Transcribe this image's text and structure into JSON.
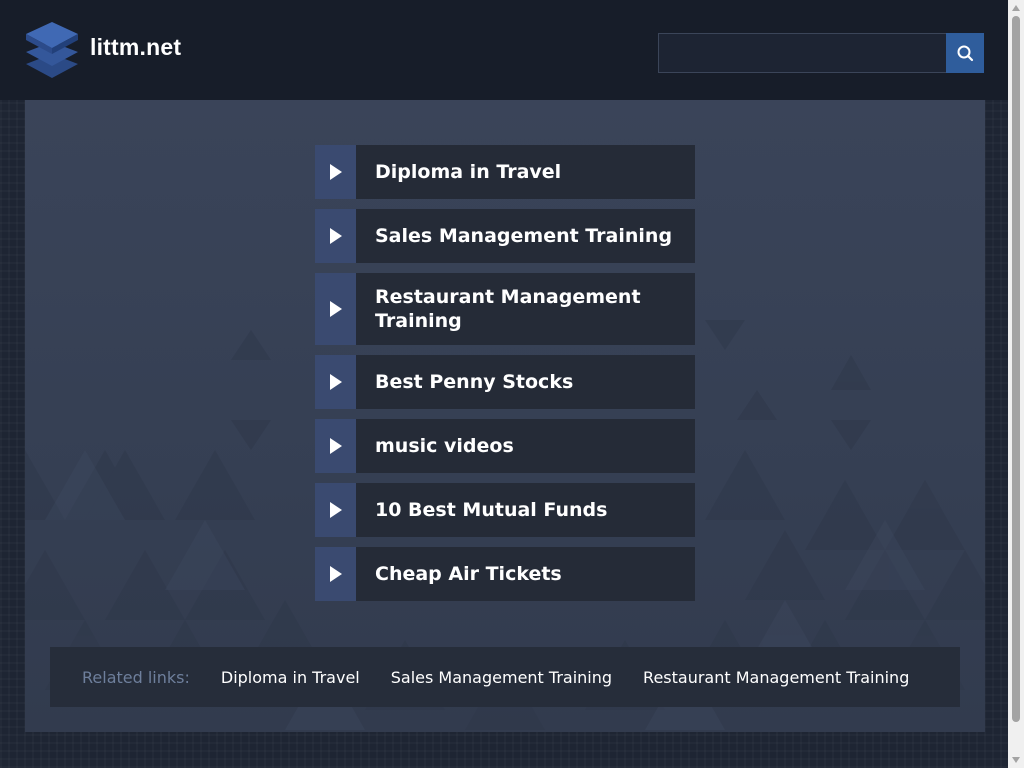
{
  "site": {
    "title": "littm.net"
  },
  "search": {
    "value": "",
    "placeholder": ""
  },
  "links": [
    {
      "label": "Diploma in Travel"
    },
    {
      "label": "Sales Management Training"
    },
    {
      "label": "Restaurant Management Training"
    },
    {
      "label": "Best Penny Stocks"
    },
    {
      "label": "music videos"
    },
    {
      "label": "10 Best Mutual Funds"
    },
    {
      "label": "Cheap Air Tickets"
    }
  ],
  "related": {
    "heading": "Related links:",
    "items": [
      {
        "label": "Diploma in Travel"
      },
      {
        "label": "Sales Management Training"
      },
      {
        "label": "Restaurant Management Training"
      }
    ]
  },
  "colors": {
    "header_bg": "#171d29",
    "panel_bg": "#3a4459",
    "accent": "#2f5d9c",
    "arrow_box": "#3a4a70",
    "link_box": "#252b37",
    "related_heading": "#6e7f9c"
  },
  "icons": {
    "logo": "stacked-layers-icon",
    "search": "search-icon",
    "link_arrow": "play-arrow-icon"
  }
}
